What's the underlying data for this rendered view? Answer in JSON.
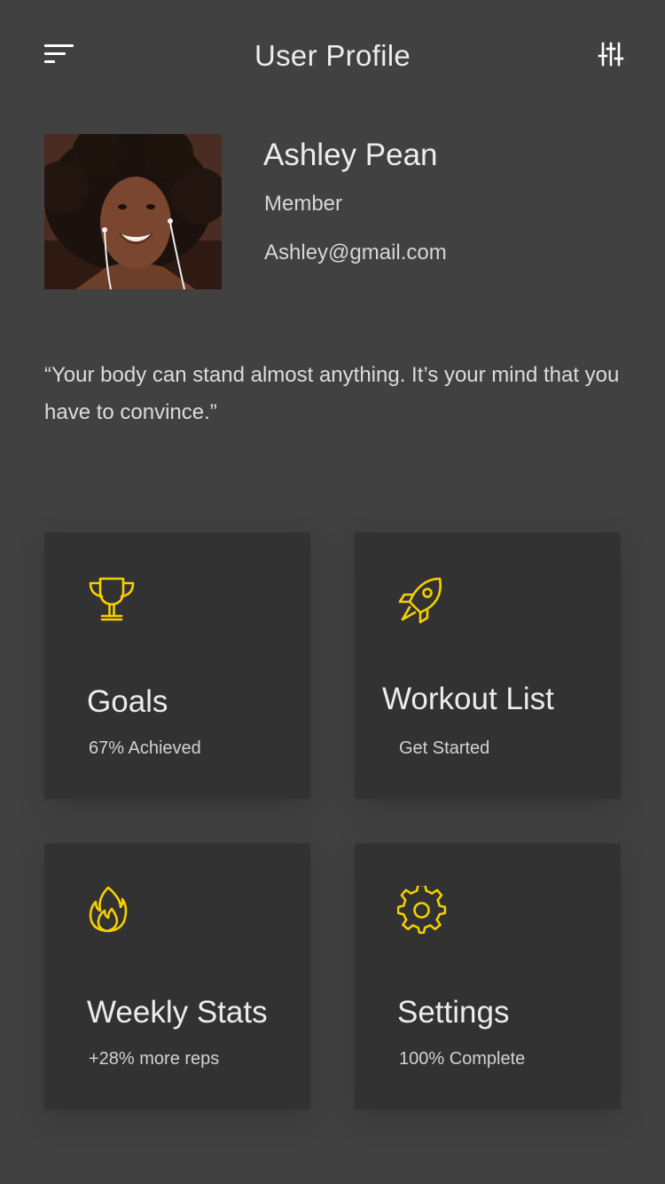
{
  "header": {
    "title": "User Profile",
    "menu_icon": "menu-icon",
    "filter_icon": "sliders-icon"
  },
  "profile": {
    "name": "Ashley Pean",
    "role": "Member",
    "email": "Ashley@gmail.com",
    "avatar": "user-photo"
  },
  "quote": "“Your body can stand almost anything. It’s your mind that you have to convince.”",
  "cards": {
    "goals": {
      "title": "Goals",
      "subtitle": "67% Achieved",
      "icon": "trophy-icon"
    },
    "workout": {
      "title": "Workout List",
      "subtitle": "Get Started",
      "icon": "rocket-icon"
    },
    "stats": {
      "title": "Weekly Stats",
      "subtitle": "+28% more reps",
      "icon": "flame-icon"
    },
    "settings": {
      "title": "Settings",
      "subtitle": "100% Complete",
      "icon": "gear-icon"
    }
  },
  "colors": {
    "background": "#414141",
    "card": "#323232",
    "accent": "#f5d000",
    "text": "#ececec"
  }
}
